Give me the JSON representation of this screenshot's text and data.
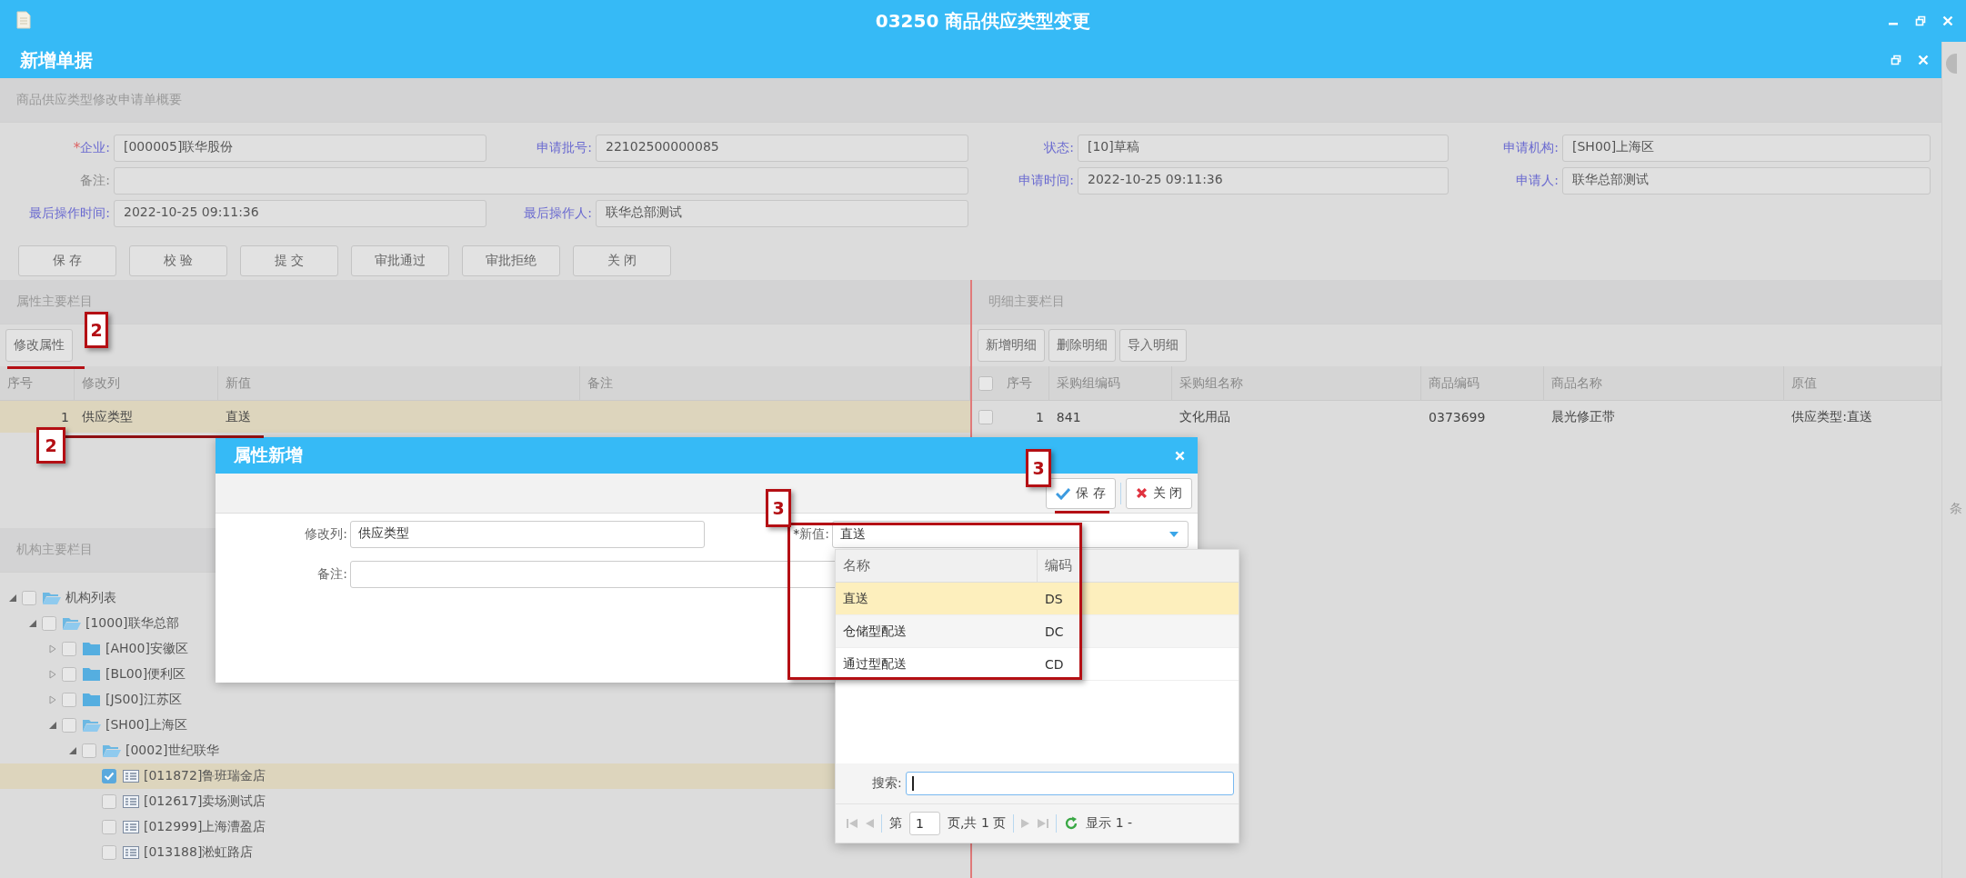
{
  "window": {
    "title": "03250 商品供应类型变更"
  },
  "document": {
    "title": "新增单据"
  },
  "summary": {
    "title": "商品供应类型修改申请单概要",
    "fields": [
      {
        "mark": "*",
        "label": "企业:",
        "value": "[000005]联华股份",
        "kind": "normal"
      },
      {
        "label": "申请批号:",
        "value": "22102500000085",
        "kind": "normal"
      },
      {
        "label": "状态:",
        "value": "[10]草稿",
        "kind": "normal"
      },
      {
        "label": "申请机构:",
        "value": "[SH00]上海区",
        "kind": "normal"
      },
      {
        "label": "备注:",
        "kind": "wide"
      },
      {
        "label": "申请时间:",
        "value": "2022-10-25 09:11:36",
        "kind": "normal"
      },
      {
        "label": "申请人:",
        "value": "联华总部测试",
        "kind": "normal"
      },
      {
        "label": "最后操作时间:",
        "value": "2022-10-25 09:11:36",
        "kind": "normal"
      },
      {
        "label": "最后操作人:",
        "value": "联华总部测试",
        "kind": "normal"
      }
    ],
    "buttons": [
      "保 存",
      "校 验",
      "提 交",
      "审批通过",
      "审批拒绝",
      "关 闭"
    ]
  },
  "attributes": {
    "title": "属性主要栏目",
    "toolbar": [
      "修改属性"
    ],
    "columns": [
      "序号",
      "修改列",
      "新值",
      "备注"
    ],
    "rows": [
      {
        "cells": [
          "1",
          "供应类型",
          "直送"
        ],
        "selected": true
      }
    ]
  },
  "details": {
    "title": "明细主要栏目",
    "toolbar": [
      "新增明细",
      "删除明细",
      "导入明细"
    ],
    "all_checked": false,
    "columns": [
      "序号",
      "采购组编码",
      "采购组名称",
      "商品编码",
      "商品名称",
      "原值"
    ],
    "rows": [
      {
        "checked": false,
        "cells": [
          "1",
          "841",
          "文化用品",
          "0373699",
          "晨光修正带",
          "供应类型:直送"
        ]
      }
    ]
  },
  "organizations": {
    "title": "机构主要栏目",
    "tree": [
      {
        "label": "机构列表",
        "kind": "folder",
        "expanded": true,
        "checked": false,
        "selected": false,
        "children": [
          {
            "label": "[1000]联华总部",
            "kind": "folder",
            "expanded": true,
            "checked": false,
            "selected": false,
            "children": [
              {
                "label": "[AH00]安徽区",
                "kind": "folder",
                "expanded": false,
                "checked": false,
                "selected": false
              },
              {
                "label": "[BL00]便利区",
                "kind": "folder",
                "expanded": false,
                "checked": false,
                "selected": false
              },
              {
                "label": "[JS00]江苏区",
                "kind": "folder",
                "expanded": false,
                "checked": false,
                "selected": false
              },
              {
                "label": "[SH00]上海区",
                "kind": "folder",
                "expanded": true,
                "checked": false,
                "selected": false,
                "children": [
                  {
                    "label": "[0002]世纪联华",
                    "kind": "folder",
                    "expanded": true,
                    "checked": false,
                    "selected": false,
                    "children": [
                      {
                        "label": "[011872]鲁班瑞金店",
                        "kind": "store",
                        "checked": true,
                        "selected": true
                      },
                      {
                        "label": "[012617]卖场测试店",
                        "kind": "store",
                        "checked": false,
                        "selected": false
                      },
                      {
                        "label": "[012999]上海漕盈店",
                        "kind": "store",
                        "checked": false,
                        "selected": false
                      },
                      {
                        "label": "[013188]淞虹路店",
                        "kind": "store",
                        "checked": false,
                        "selected": false
                      }
                    ]
                  }
                ]
              }
            ]
          }
        ]
      }
    ]
  },
  "dialog": {
    "title": "属性新增",
    "buttons": [
      {
        "label": "保 存",
        "kind": "save"
      },
      {
        "label": "关 闭",
        "kind": "close"
      }
    ],
    "fields": [
      {
        "label": "修改列:",
        "value": "供应类型"
      },
      {
        "label": "备注:"
      }
    ],
    "new_value": {
      "mark": "*",
      "label": "新值:",
      "value": "直送"
    }
  },
  "dropdown": {
    "columns": [
      "名称",
      "编码"
    ],
    "rows": [
      {
        "name": "直送",
        "code": "DS",
        "selected": true
      },
      {
        "name": "仓储型配送",
        "code": "DC",
        "selected": false
      },
      {
        "name": "通过型配送",
        "code": "CD",
        "selected": false
      }
    ],
    "search": {
      "label": "搜索:"
    },
    "pager": {
      "page_prefix": "第",
      "page": "1",
      "page_suffix": "页,共 1 页",
      "info": "显示 1 -"
    }
  },
  "annotations": [
    {
      "label": "2"
    },
    {
      "label": "2"
    },
    {
      "label": "3"
    },
    {
      "label": "3"
    }
  ],
  "edge_text": "条"
}
